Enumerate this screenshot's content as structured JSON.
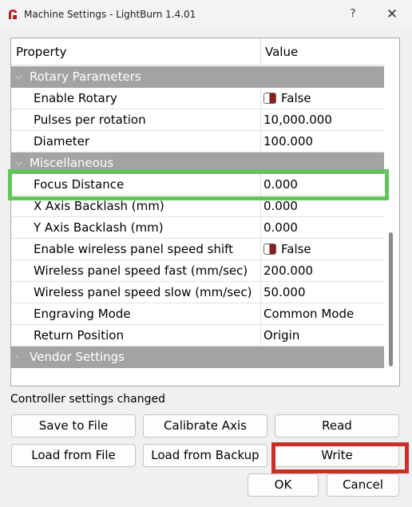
{
  "window": {
    "title": "Machine Settings - LightBurn 1.4.01",
    "help_label": "?",
    "close_label": "✕"
  },
  "grid": {
    "columns": {
      "property": "Property",
      "value": "Value"
    },
    "categories": {
      "rotary": "Rotary Parameters",
      "misc": "Miscellaneous",
      "vendor": "Vendor Settings"
    },
    "rotary_rows": [
      {
        "name": "Enable Rotary",
        "value": "False",
        "toggle": true
      },
      {
        "name": "Pulses per rotation",
        "value": "10,000.000"
      },
      {
        "name": "Diameter",
        "value": "100.000"
      }
    ],
    "misc_rows": [
      {
        "name": "Focus Distance",
        "value": "0.000"
      },
      {
        "name": "X Axis Backlash (mm)",
        "value": "0.000"
      },
      {
        "name": "Y Axis Backlash (mm)",
        "value": "0.000"
      },
      {
        "name": "Enable wireless panel speed shift",
        "value": "False",
        "toggle": true
      },
      {
        "name": "Wireless panel speed fast (mm/sec)",
        "value": "200.000"
      },
      {
        "name": "Wireless panel speed slow (mm/sec)",
        "value": "50.000"
      },
      {
        "name": "Engraving Mode",
        "value": "Common Mode"
      },
      {
        "name": "Return Position",
        "value": "Origin"
      }
    ]
  },
  "status": "Controller settings changed",
  "buttons": {
    "save_to_file": "Save to File",
    "calibrate_axis": "Calibrate Axis",
    "read": "Read",
    "load_from_file": "Load from File",
    "load_from_backup": "Load from Backup",
    "write": "Write",
    "ok": "OK",
    "cancel": "Cancel"
  },
  "colors": {
    "category_bg": "#a3a3a3",
    "highlight_green": "#62c55a",
    "highlight_red": "#c9302c",
    "toggle_red": "#8b1d1d"
  }
}
